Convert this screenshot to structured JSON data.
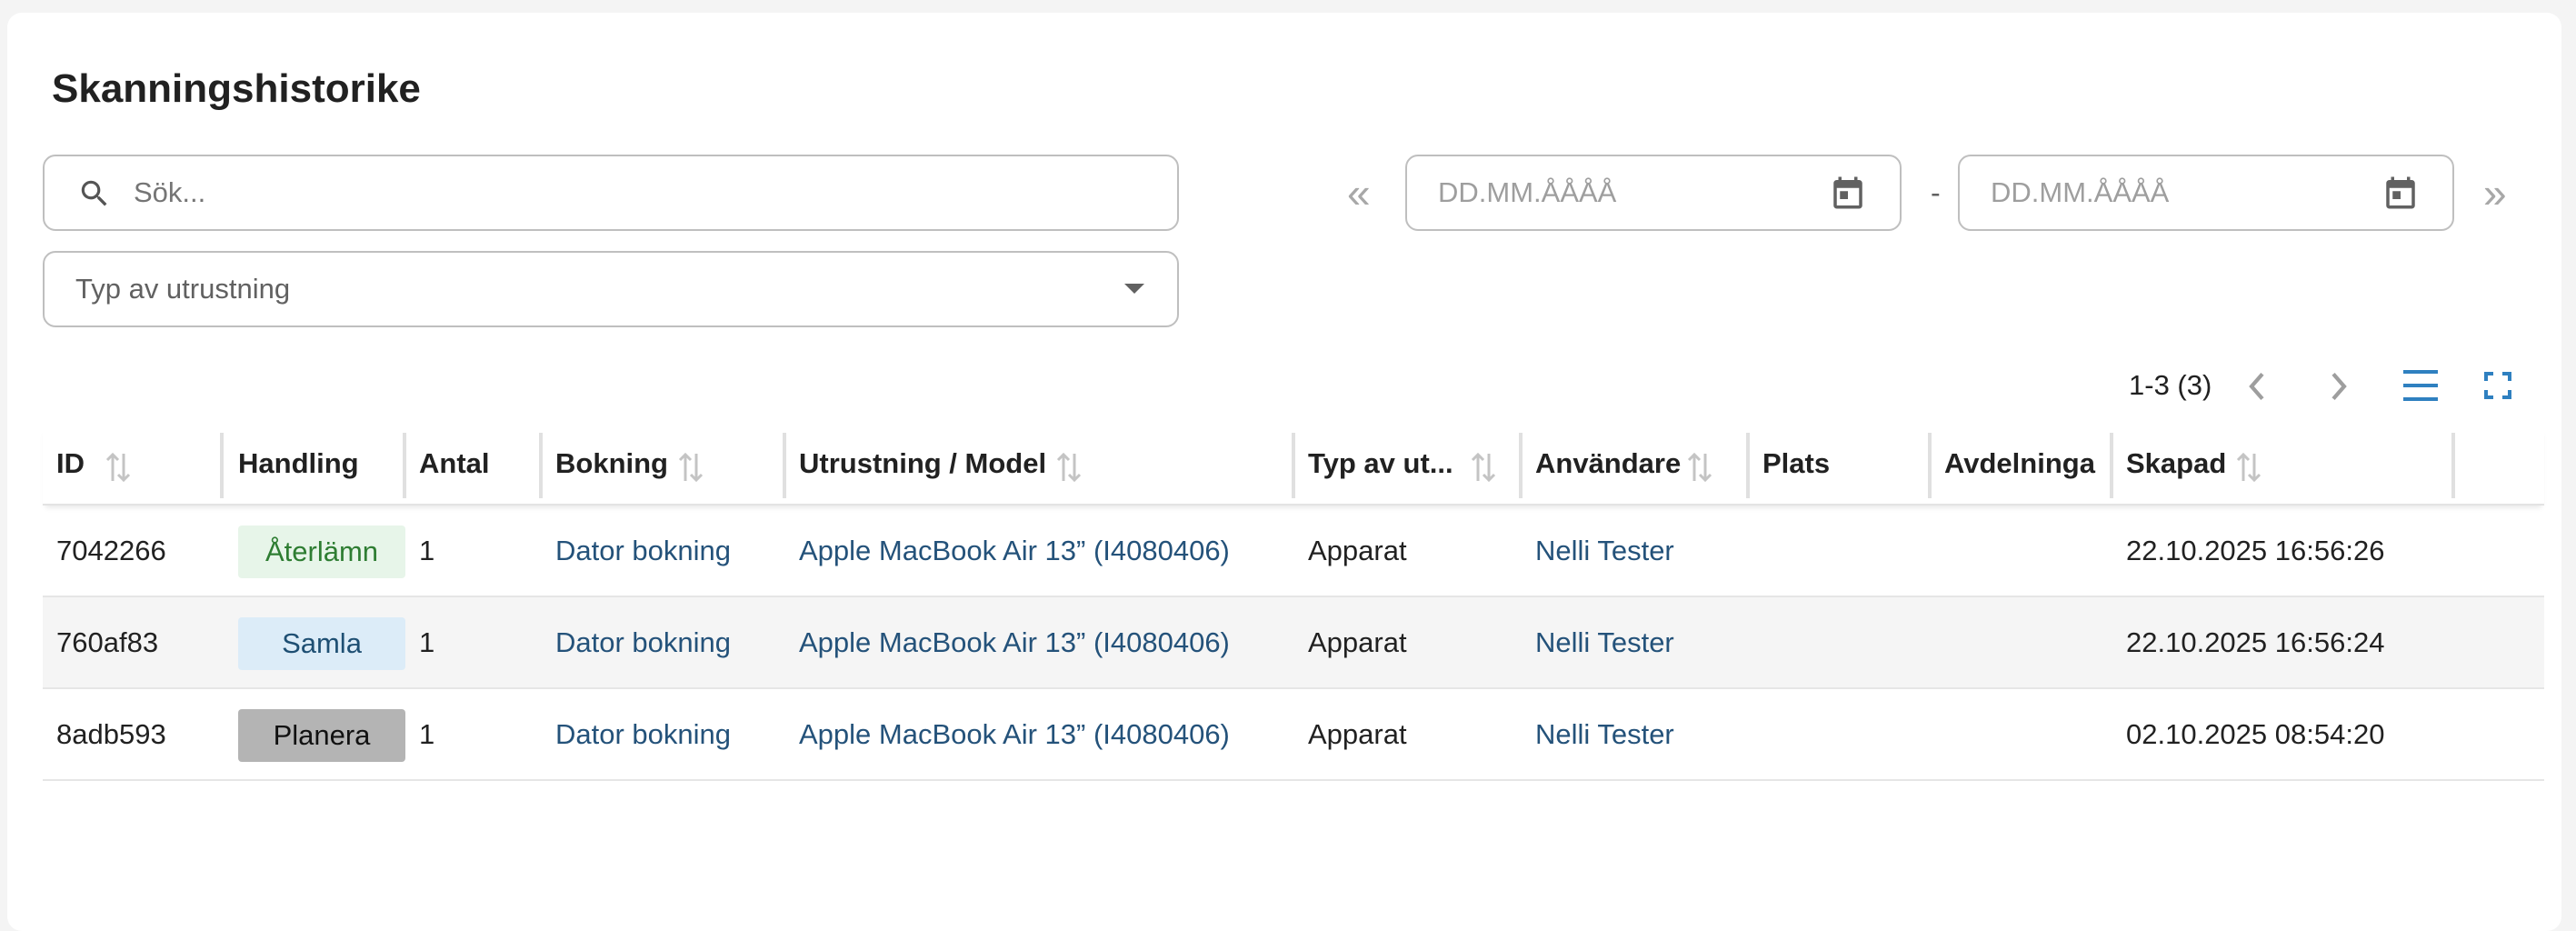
{
  "page": {
    "title": "Skanningshistorike"
  },
  "filters": {
    "search_placeholder": "Sök...",
    "equipment_type_placeholder": "Typ av utrustning",
    "date_from_placeholder": "DD.MM.ÅÅÅÅ",
    "date_to_placeholder": "DD.MM.ÅÅÅÅ",
    "date_separator": "-",
    "prev_range_glyph": "«",
    "next_range_glyph": "»"
  },
  "pagination": {
    "range_text": "1-3 (3)"
  },
  "table": {
    "columns": [
      "ID",
      "Handling",
      "Antal",
      "Bokning",
      "Utrustning / Model",
      "Typ av ut...",
      "Användare",
      "Plats",
      "Avdelninga",
      "Skapad"
    ],
    "rows": [
      {
        "id": "7042266",
        "action": "Återlämn",
        "action_color": "#e7f5e9",
        "count": "1",
        "booking": "Dator bokning",
        "equipment": "Apple MacBook Air 13” (I4080406)",
        "type": "Apparat",
        "user": "Nelli Tester",
        "place": "",
        "department": "",
        "created": "22.10.2025 16:56:26"
      },
      {
        "id": "760af83",
        "action": "Samla",
        "action_color": "#dcecf8",
        "count": "1",
        "booking": "Dator bokning",
        "equipment": "Apple MacBook Air 13” (I4080406)",
        "type": "Apparat",
        "user": "Nelli Tester",
        "place": "",
        "department": "",
        "created": "22.10.2025 16:56:24"
      },
      {
        "id": "8adb593",
        "action": "Planera",
        "action_color": "#b4b4b4",
        "count": "1",
        "booking": "Dator bokning",
        "equipment": "Apple MacBook Air 13” (I4080406)",
        "type": "Apparat",
        "user": "Nelli Tester",
        "place": "",
        "department": "",
        "created": "02.10.2025 08:54:20"
      }
    ]
  },
  "colors": {
    "link": "#24527a",
    "accent": "#2f80c0"
  },
  "icons": [
    "search-icon",
    "chevron-down-icon",
    "calendar-icon",
    "double-chevron-left-icon",
    "double-chevron-right-icon",
    "chevron-left-icon",
    "chevron-right-icon",
    "list-view-icon",
    "fullscreen-icon",
    "sort-icon"
  ]
}
